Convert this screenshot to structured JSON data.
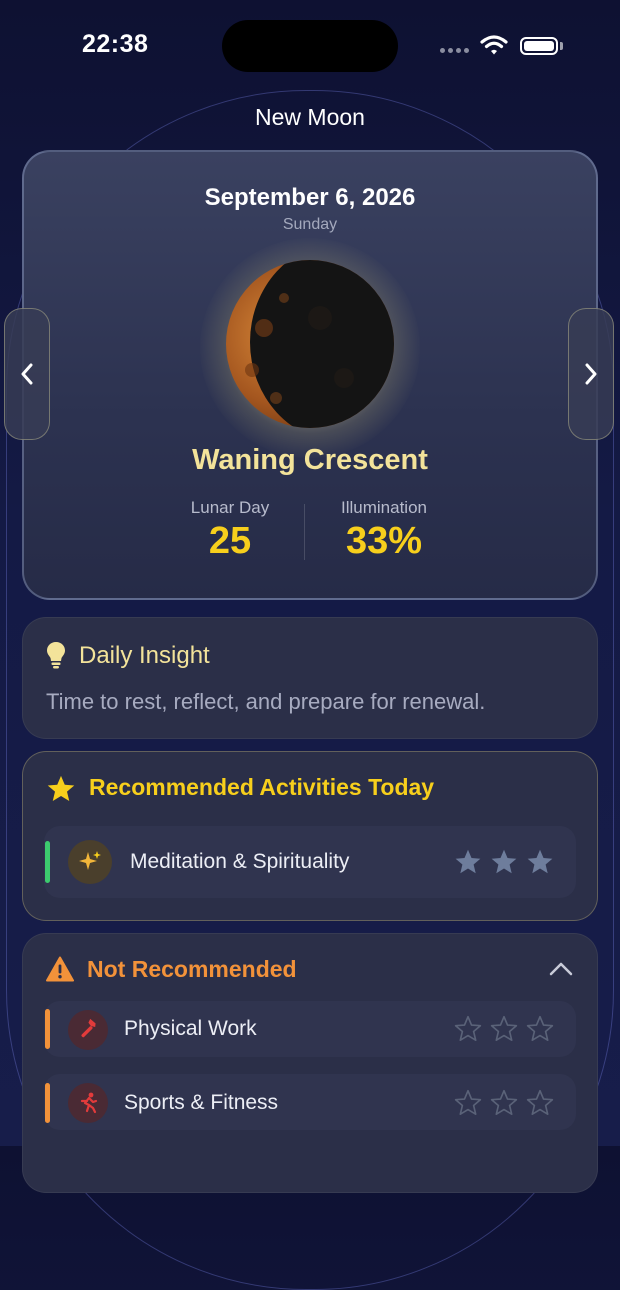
{
  "status_bar": {
    "time": "22:38"
  },
  "header": {
    "title": "New Moon"
  },
  "moon": {
    "date": "September 6, 2026",
    "weekday": "Sunday",
    "phase_name": "Waning Crescent",
    "lunar_day_label": "Lunar Day",
    "lunar_day_value": "25",
    "illumination_label": "Illumination",
    "illumination_value": "33%"
  },
  "insight": {
    "title": "Daily Insight",
    "text": "Time to rest, reflect, and prepare for renewal."
  },
  "recommended": {
    "title": "Recommended Activities Today",
    "items": [
      {
        "label": "Meditation & Spirituality",
        "rating": 3,
        "icon": "sparkles-icon",
        "accent": "#3ccb6e"
      }
    ]
  },
  "not_recommended": {
    "title": "Not Recommended",
    "items": [
      {
        "label": "Physical Work",
        "rating": 0,
        "icon": "hammer-icon",
        "accent": "#f2923a"
      },
      {
        "label": "Sports & Fitness",
        "rating": 0,
        "icon": "runner-icon",
        "accent": "#f2923a"
      }
    ]
  },
  "colors": {
    "accent_yellow": "#f7cf1c",
    "phase_text": "#f3e39a",
    "warning_orange": "#f2923a",
    "background": "#141a45"
  }
}
